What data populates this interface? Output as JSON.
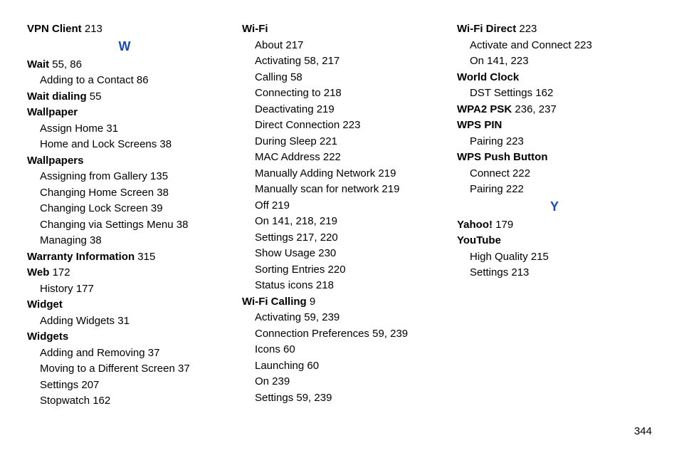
{
  "pageNumber": "344",
  "letters": {
    "W": "W",
    "Y": "Y"
  },
  "col1": {
    "vpnClient": {
      "term": "VPN Client",
      "pages": " 213"
    },
    "wait": {
      "term": "Wait",
      "pages": " 55, 86",
      "subs": [
        {
          "label": "Adding to a Contact",
          "pages": " 86"
        }
      ]
    },
    "waitDialing": {
      "term": "Wait dialing",
      "pages": " 55"
    },
    "wallpaper": {
      "term": "Wallpaper",
      "pages": "",
      "subs": [
        {
          "label": "Assign Home",
          "pages": " 31"
        },
        {
          "label": "Home and Lock Screens",
          "pages": " 38"
        }
      ]
    },
    "wallpapers": {
      "term": "Wallpapers",
      "pages": "",
      "subs": [
        {
          "label": "Assigning from Gallery",
          "pages": " 135"
        },
        {
          "label": "Changing Home Screen",
          "pages": " 38"
        },
        {
          "label": "Changing Lock Screen",
          "pages": " 39"
        },
        {
          "label": "Changing via Settings Menu",
          "pages": " 38"
        },
        {
          "label": "Managing",
          "pages": " 38"
        }
      ]
    },
    "warranty": {
      "term": "Warranty Information",
      "pages": " 315"
    },
    "web": {
      "term": "Web",
      "pages": " 172",
      "subs": [
        {
          "label": "History",
          "pages": " 177"
        }
      ]
    },
    "widget": {
      "term": "Widget",
      "pages": "",
      "subs": [
        {
          "label": "Adding Widgets",
          "pages": " 31"
        }
      ]
    },
    "widgets": {
      "term": "Widgets",
      "pages": "",
      "subs": [
        {
          "label": "Adding and Removing",
          "pages": " 37"
        },
        {
          "label": "Moving to a Different Screen",
          "pages": " 37"
        },
        {
          "label": "Settings",
          "pages": " 207"
        },
        {
          "label": "Stopwatch",
          "pages": " 162"
        }
      ]
    }
  },
  "col2": {
    "wifi": {
      "term": "Wi-Fi",
      "pages": "",
      "subs": [
        {
          "label": "About",
          "pages": " 217"
        },
        {
          "label": "Activating",
          "pages": " 58, 217"
        },
        {
          "label": "Calling",
          "pages": " 58"
        },
        {
          "label": "Connecting to",
          "pages": " 218"
        },
        {
          "label": "Deactivating",
          "pages": " 219"
        },
        {
          "label": "Direct Connection",
          "pages": " 223"
        },
        {
          "label": "During Sleep",
          "pages": " 221"
        },
        {
          "label": "MAC Address",
          "pages": " 222"
        },
        {
          "label": "Manually Adding Network",
          "pages": " 219"
        },
        {
          "label": "Manually scan for network",
          "pages": " 219"
        },
        {
          "label": "Off",
          "pages": " 219"
        },
        {
          "label": "On",
          "pages": " 141, 218, 219"
        },
        {
          "label": "Settings",
          "pages": " 217, 220"
        },
        {
          "label": "Show Usage",
          "pages": " 230"
        },
        {
          "label": "Sorting Entries",
          "pages": " 220"
        },
        {
          "label": "Status icons",
          "pages": " 218"
        }
      ]
    },
    "wifiCalling": {
      "term": "Wi-Fi Calling",
      "pages": " 9",
      "subs": [
        {
          "label": "Activating",
          "pages": " 59, 239"
        },
        {
          "label": "Connection Preferences",
          "pages": " 59, 239"
        },
        {
          "label": "Icons",
          "pages": " 60"
        },
        {
          "label": "Launching",
          "pages": " 60"
        },
        {
          "label": "On",
          "pages": " 239"
        },
        {
          "label": "Settings",
          "pages": " 59, 239"
        }
      ]
    }
  },
  "col3": {
    "wifiDirect": {
      "term": "Wi-Fi Direct",
      "pages": " 223",
      "subs": [
        {
          "label": "Activate and Connect",
          "pages": " 223"
        },
        {
          "label": "On",
          "pages": " 141, 223"
        }
      ]
    },
    "worldClock": {
      "term": "World Clock",
      "pages": "",
      "subs": [
        {
          "label": "DST Settings",
          "pages": " 162"
        }
      ]
    },
    "wpa2": {
      "term": "WPA2 PSK",
      "pages": " 236, 237"
    },
    "wpsPin": {
      "term": "WPS PIN",
      "pages": "",
      "subs": [
        {
          "label": "Pairing",
          "pages": " 223"
        }
      ]
    },
    "wpsPush": {
      "term": "WPS Push Button",
      "pages": "",
      "subs": [
        {
          "label": "Connect",
          "pages": " 222"
        },
        {
          "label": "Pairing",
          "pages": " 222"
        }
      ]
    },
    "yahoo": {
      "term": "Yahoo!",
      "pages": " 179"
    },
    "youtube": {
      "term": "YouTube",
      "pages": "",
      "subs": [
        {
          "label": "High Quality",
          "pages": " 215"
        },
        {
          "label": "Settings",
          "pages": " 213"
        }
      ]
    }
  }
}
